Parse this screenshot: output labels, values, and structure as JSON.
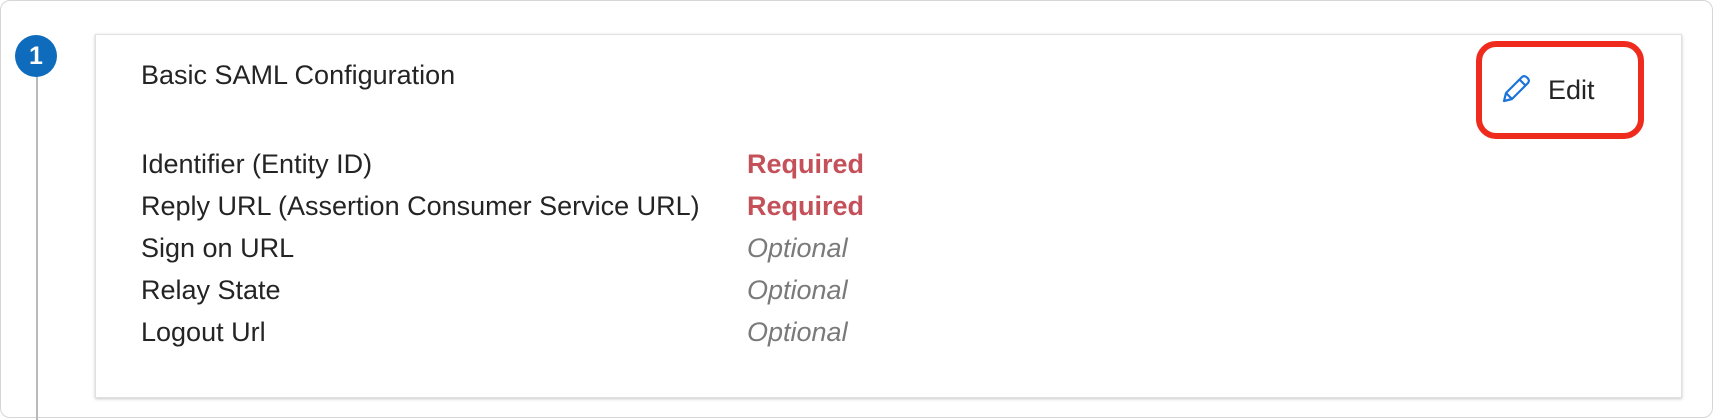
{
  "step": {
    "number": "1"
  },
  "card": {
    "title": "Basic SAML Configuration",
    "edit": {
      "label": "Edit",
      "icon": "pencil-icon",
      "icon_color": "#1a73d8",
      "highlight_color": "#ef2b1d"
    },
    "rows": [
      {
        "label": "Identifier (Entity ID)",
        "status": "Required",
        "kind": "required"
      },
      {
        "label": "Reply URL (Assertion Consumer Service URL)",
        "status": "Required",
        "kind": "required"
      },
      {
        "label": "Sign on URL",
        "status": "Optional",
        "kind": "optional"
      },
      {
        "label": "Relay State",
        "status": "Optional",
        "kind": "optional"
      },
      {
        "label": "Logout Url",
        "status": "Optional",
        "kind": "optional"
      }
    ]
  },
  "colors": {
    "step_badge": "#0f6cbd",
    "required_text": "#c4505a",
    "optional_text": "#7a7a7a"
  }
}
